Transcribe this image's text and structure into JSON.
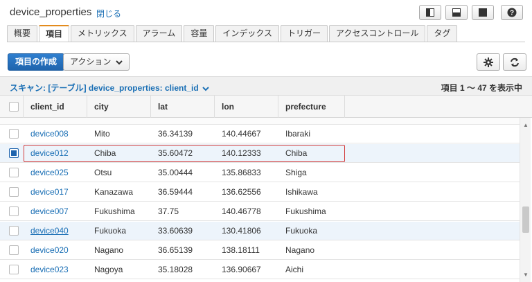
{
  "header": {
    "title": "device_properties",
    "close_label": "閉じる"
  },
  "tabs": [
    {
      "label": "概要"
    },
    {
      "label": "項目"
    },
    {
      "label": "メトリックス"
    },
    {
      "label": "アラーム"
    },
    {
      "label": "容量"
    },
    {
      "label": "インデックス"
    },
    {
      "label": "トリガー"
    },
    {
      "label": "アクセスコントロール"
    },
    {
      "label": "タグ"
    }
  ],
  "active_tab": "項目",
  "toolbar": {
    "create_label": "項目の作成",
    "action_label": "アクション"
  },
  "scan": {
    "text": "スキャン: [テーブル] device_properties: client_id",
    "count": "項目 1 ～ 47 を表示中"
  },
  "columns": [
    "client_id",
    "city",
    "lat",
    "lon",
    "prefecture"
  ],
  "rows": [
    {
      "client_id": "device008",
      "city": "Mito",
      "lat": "36.34139",
      "lon": "140.44667",
      "prefecture": "Ibaraki",
      "checked": false
    },
    {
      "client_id": "device012",
      "city": "Chiba",
      "lat": "35.60472",
      "lon": "140.12333",
      "prefecture": "Chiba",
      "checked": true
    },
    {
      "client_id": "device025",
      "city": "Otsu",
      "lat": "35.00444",
      "lon": "135.86833",
      "prefecture": "Shiga",
      "checked": false
    },
    {
      "client_id": "device017",
      "city": "Kanazawa",
      "lat": "36.59444",
      "lon": "136.62556",
      "prefecture": "Ishikawa",
      "checked": false
    },
    {
      "client_id": "device007",
      "city": "Fukushima",
      "lat": "37.75",
      "lon": "140.46778",
      "prefecture": "Fukushima",
      "checked": false
    },
    {
      "client_id": "device040",
      "city": "Fukuoka",
      "lat": "33.60639",
      "lon": "130.41806",
      "prefecture": "Fukuoka",
      "checked": false
    },
    {
      "client_id": "device020",
      "city": "Nagano",
      "lat": "36.65139",
      "lon": "138.18111",
      "prefecture": "Nagano",
      "checked": false
    },
    {
      "client_id": "device023",
      "city": "Nagoya",
      "lat": "35.18028",
      "lon": "136.90667",
      "prefecture": "Aichi",
      "checked": false
    }
  ],
  "colors": {
    "accent": "#1f64ad",
    "link": "#1a6fb5",
    "active_tab_border": "#e38b1d",
    "annotation": "#d23a3a"
  },
  "icons": [
    "column-layout-icon",
    "row-layout-icon",
    "full-layout-icon",
    "help-icon",
    "chevron-down-icon",
    "gear-icon",
    "refresh-icon"
  ]
}
